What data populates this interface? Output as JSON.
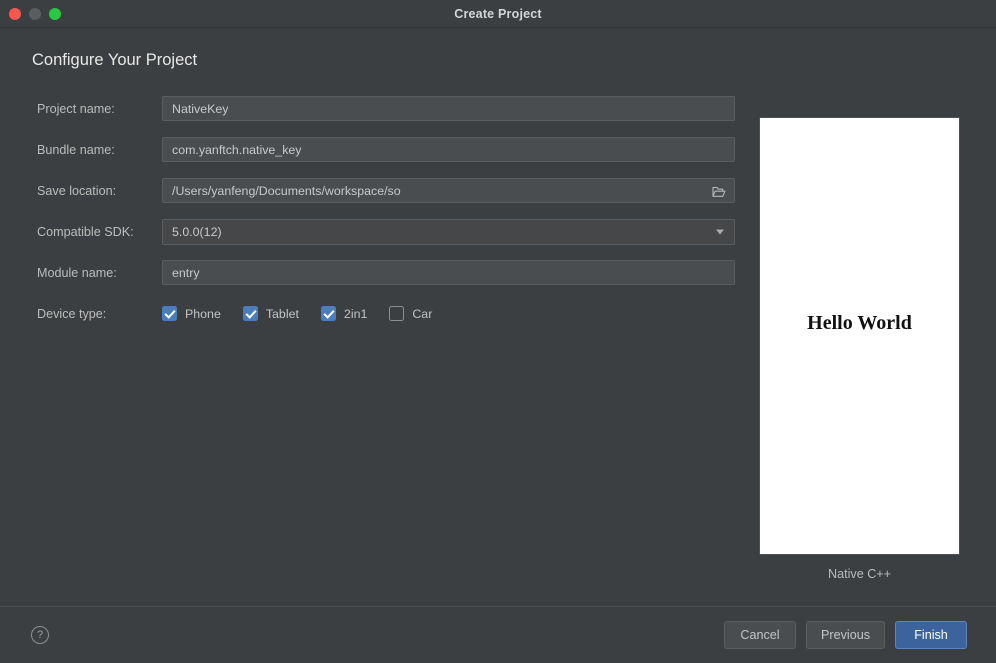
{
  "window": {
    "title": "Create Project",
    "traffic_lights": [
      "close-button",
      "minimize-button",
      "zoom-button"
    ]
  },
  "page": {
    "heading": "Configure Your Project"
  },
  "form": {
    "fields": [
      {
        "label": "Project name:",
        "value": "NativeKey",
        "type": "text"
      },
      {
        "label": "Bundle name:",
        "value": "com.yanftch.native_key",
        "type": "text"
      },
      {
        "label": "Save location:",
        "value": "/Users/yanfeng/Documents/workspace/so",
        "type": "text-browse",
        "icon": "folder-icon"
      },
      {
        "label": "Compatible SDK:",
        "value": "5.0.0(12)",
        "type": "select",
        "icon": "chevron-down-icon"
      },
      {
        "label": "Module name:",
        "value": "entry",
        "type": "text"
      }
    ],
    "device_type": {
      "label": "Device type:",
      "options": [
        {
          "label": "Phone",
          "checked": true
        },
        {
          "label": "Tablet",
          "checked": true
        },
        {
          "label": "2in1",
          "checked": true
        },
        {
          "label": "Car",
          "checked": false
        }
      ]
    }
  },
  "preview": {
    "screen_text": "Hello World",
    "caption": "Native C++"
  },
  "footer": {
    "help_glyph": "?",
    "buttons": [
      {
        "label": "Cancel",
        "style": "secondary"
      },
      {
        "label": "Previous",
        "style": "secondary"
      },
      {
        "label": "Finish",
        "style": "primary"
      }
    ]
  },
  "colors": {
    "window_bg": "#3c3f41",
    "field_bg": "#494d50",
    "accent_blue": "#4a7ebb",
    "primary_button": "#3c639c",
    "text": "#c8c9ca",
    "traffic_close": "#f9564f",
    "traffic_minimize": "#5b5e60",
    "traffic_zoom": "#26c940"
  }
}
